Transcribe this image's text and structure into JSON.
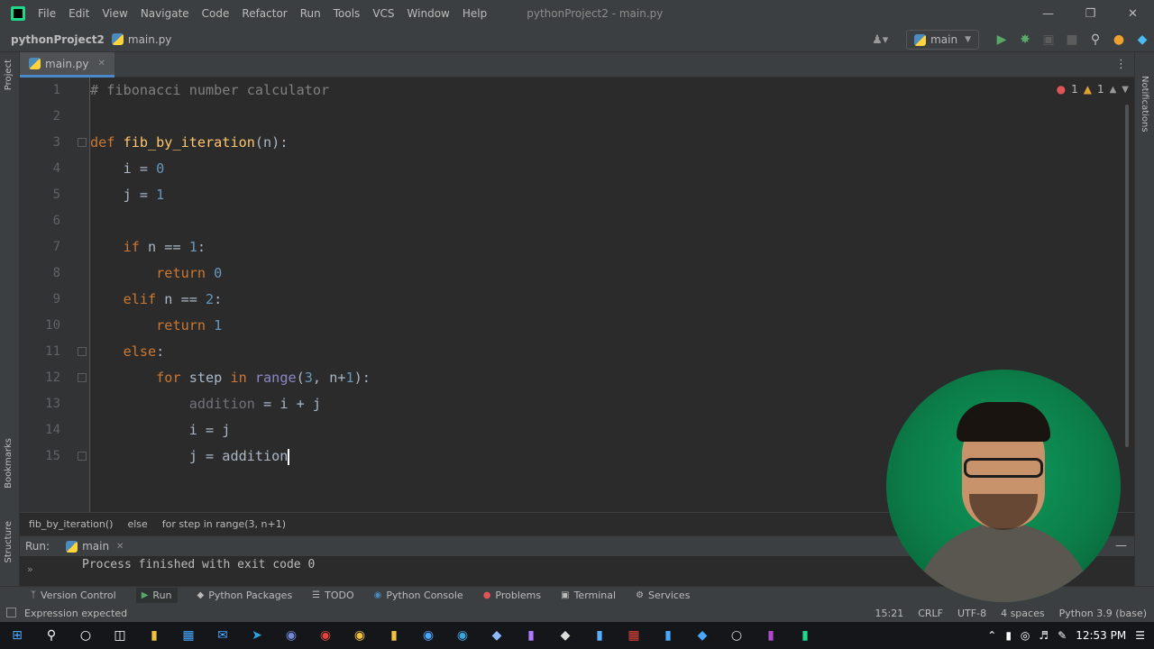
{
  "menubar": {
    "items": [
      "File",
      "Edit",
      "View",
      "Navigate",
      "Code",
      "Refactor",
      "Run",
      "Tools",
      "VCS",
      "Window",
      "Help"
    ],
    "window_title": "pythonProject2 - main.py"
  },
  "navbar": {
    "project": "pythonProject2",
    "file": "main.py",
    "run_config": "main"
  },
  "tabs": [
    {
      "label": "main.py",
      "active": true
    }
  ],
  "left_strip": {
    "project": "Project",
    "bookmarks": "Bookmarks",
    "structure": "Structure"
  },
  "right_strip": {
    "notifications": "Notifications"
  },
  "inspection": {
    "errors": "1",
    "warnings": "1"
  },
  "code_lines": [
    "1",
    "2",
    "3",
    "4",
    "5",
    "6",
    "7",
    "8",
    "9",
    "10",
    "11",
    "12",
    "13",
    "14",
    "15"
  ],
  "breadcrumbs": [
    "fib_by_iteration()",
    "else",
    "for step in range(3, n+1)"
  ],
  "run_panel": {
    "label": "Run:",
    "tab": "main",
    "output": "Process finished with exit code 0"
  },
  "tool_windows": [
    "Version Control",
    "Run",
    "Python Packages",
    "TODO",
    "Python Console",
    "Problems",
    "Terminal",
    "Services"
  ],
  "status": {
    "message": "Expression expected",
    "position": "15:21",
    "line_ending": "CRLF",
    "encoding": "UTF-8",
    "indent": "4 spaces",
    "interpreter": "Python 3.9 (base)"
  },
  "taskbar": {
    "time": "12:53 PM"
  },
  "colors": {
    "keyword": "#cc7832",
    "function": "#ffc66d",
    "number": "#6897bb",
    "comment": "#808080",
    "accent": "#4a88c7"
  }
}
